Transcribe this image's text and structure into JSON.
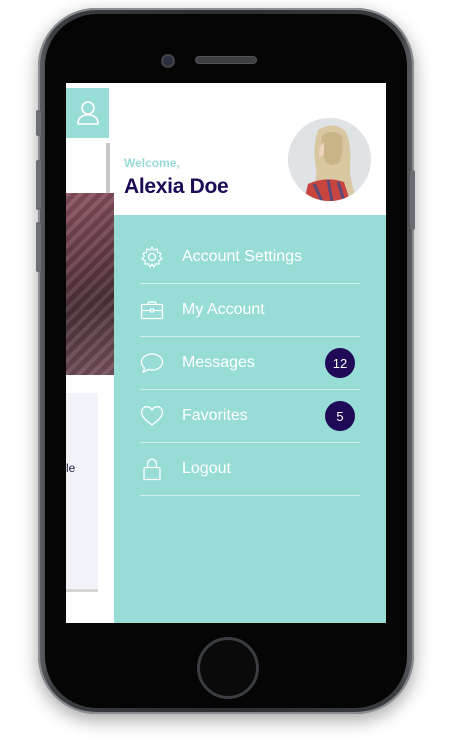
{
  "drawer": {
    "welcome": "Welcome,",
    "user_name": "Alexia Doe",
    "menu": [
      {
        "label": "Account Settings",
        "icon": "gear-icon"
      },
      {
        "label": "My Account",
        "icon": "briefcase-icon"
      },
      {
        "label": "Messages",
        "icon": "chat-bubble-icon",
        "badge": "12"
      },
      {
        "label": "Favorites",
        "icon": "heart-icon",
        "badge": "5"
      },
      {
        "label": "Logout",
        "icon": "lock-icon"
      }
    ]
  },
  "background_app": {
    "card_text": "le",
    "user_button_icon": "user-icon"
  },
  "colors": {
    "accent": "#97dcd5",
    "brand": "#1e0a57"
  }
}
